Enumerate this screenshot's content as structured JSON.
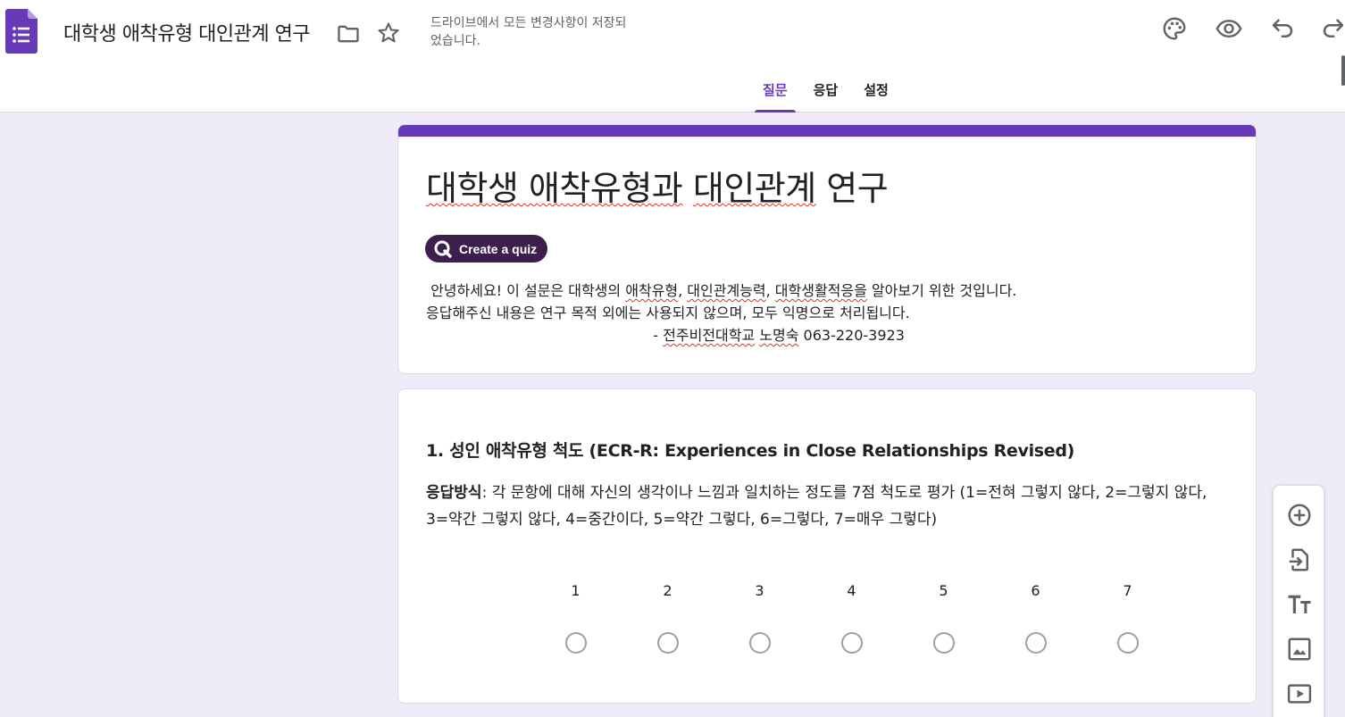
{
  "header": {
    "doc_title": "대학생 애착유형 대인관계 연구",
    "save_status": "드라이브에서 모든 변경사항이 저장되었습니다."
  },
  "tabs": [
    {
      "label": "질문",
      "active": true
    },
    {
      "label": "응답",
      "active": false
    },
    {
      "label": "설정",
      "active": false
    }
  ],
  "form": {
    "title": "대학생 애착유형과 대인관계 연구",
    "quiz_button_label": "Create a quiz",
    "description": {
      "line1_pre": " 안녕하세요! 이 설문은 대학생의 ",
      "line1_w1": "애착유형",
      "line1_mid1": ", ",
      "line1_w2": "대인관계능력",
      "line1_mid2": ", ",
      "line1_w3": "대학생활적응을",
      "line1_post": " 알아보기 위한 것입니다.",
      "line2": "응답해주신 내용은 연구 목적 외에는 사용되지 않으며, 모두 익명으로 처리됩니다.",
      "line3_pre": "                                                  - ",
      "line3_w1": "전주비전대학교",
      "line3_mid": " ",
      "line3_w2": "노명숙",
      "line3_post": " 063-220-3923"
    }
  },
  "question": {
    "title": "1. 성인 애착유형 척도 (ECR-R: Experiences in Close Relationships Revised)",
    "desc_bold": "응답방식",
    "desc_text": ": 각 문항에 대해 자신의 생각이나 느낌과 일치하는 정도를 7점 척도로 평가 (1=전혀 그렇지 않다, 2=그렇지 않다, 3=약간 그렇지 않다, 4=중간이다, 5=약간 그렇다, 6=그렇다, 7=매우 그렇다)",
    "scale": [
      "1",
      "2",
      "3",
      "4",
      "5",
      "6",
      "7"
    ]
  },
  "icons": {
    "app": "forms-logo-icon",
    "folder": "folder-icon",
    "star": "star-icon",
    "palette": "palette-icon",
    "preview": "eye-icon",
    "undo": "undo-icon",
    "redo": "redo-icon",
    "toolbar": [
      "add-circle-icon",
      "import-icon",
      "title-text-icon",
      "image-icon",
      "video-icon"
    ]
  },
  "colors": {
    "accent": "#673ab7",
    "background": "#efebf8",
    "quiz_button": "#3c1f4d"
  }
}
